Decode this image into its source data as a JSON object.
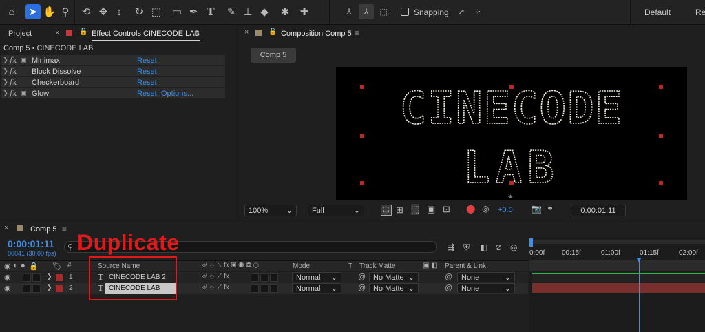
{
  "toolbar": {
    "snapping_label": "Snapping",
    "workspace_default": "Default",
    "workspace_next": "Re",
    "icons": [
      "home-icon",
      "selection-tool-icon",
      "hand-tool-icon",
      "zoom-tool-icon",
      "orbit-camera-icon",
      "pan-camera-icon",
      "dolly-camera-icon",
      "rotate-tool-icon",
      "pan-behind-icon",
      "rectangle-tool-icon",
      "pen-tool-icon",
      "type-tool-icon",
      "brush-tool-icon",
      "clone-stamp-icon",
      "eraser-icon",
      "roto-brush-icon",
      "puppet-pin-icon"
    ]
  },
  "left_panel": {
    "tabs": {
      "project": "Project",
      "effect_controls": "Effect Controls CINECODE LAB"
    },
    "breadcrumb": "Comp 5 • CINECODE LAB",
    "effects": [
      {
        "name": "Minimax",
        "reset": "Reset",
        "options": ""
      },
      {
        "name": "Block Dissolve",
        "reset": "Reset",
        "options": ""
      },
      {
        "name": "Checkerboard",
        "reset": "Reset",
        "options": ""
      },
      {
        "name": "Glow",
        "reset": "Reset",
        "options": "Options..."
      }
    ]
  },
  "composition_panel": {
    "tab_title": "Composition Comp 5",
    "comp_tab": "Comp 5",
    "viewer_text_line1": "CINECODE",
    "viewer_text_line2": "LAB",
    "zoom": "100%",
    "resolution": "Full",
    "exposure": "+0.0",
    "timecode": "0:00:01:11"
  },
  "timeline": {
    "tab_title": "Comp 5",
    "current_time": "0:00:01:11",
    "frame_info": "00041 (30.00 fps)",
    "annotation": "Duplicate",
    "columns": {
      "num": "#",
      "source_name": "Source Name",
      "mode": "Mode",
      "t": "T",
      "track_matte": "Track Matte",
      "parent": "Parent & Link"
    },
    "layers": [
      {
        "index": "1",
        "name": "CINECODE LAB 2",
        "mode": "Normal",
        "matte": "No Matte",
        "parent": "None"
      },
      {
        "index": "2",
        "name": "CINECODE LAB",
        "mode": "Normal",
        "matte": "No Matte",
        "parent": "None"
      }
    ],
    "ruler": [
      "0:00f",
      "00:15f",
      "01:00f",
      "01:15f",
      "02:00f"
    ]
  },
  "colors": {
    "accent": "#2c6fe0",
    "timecode_blue": "#3d8fe8",
    "annotation_red": "#e01a1a",
    "layer_label_red": "#a72a2a",
    "track_green": "#2fb34a"
  }
}
